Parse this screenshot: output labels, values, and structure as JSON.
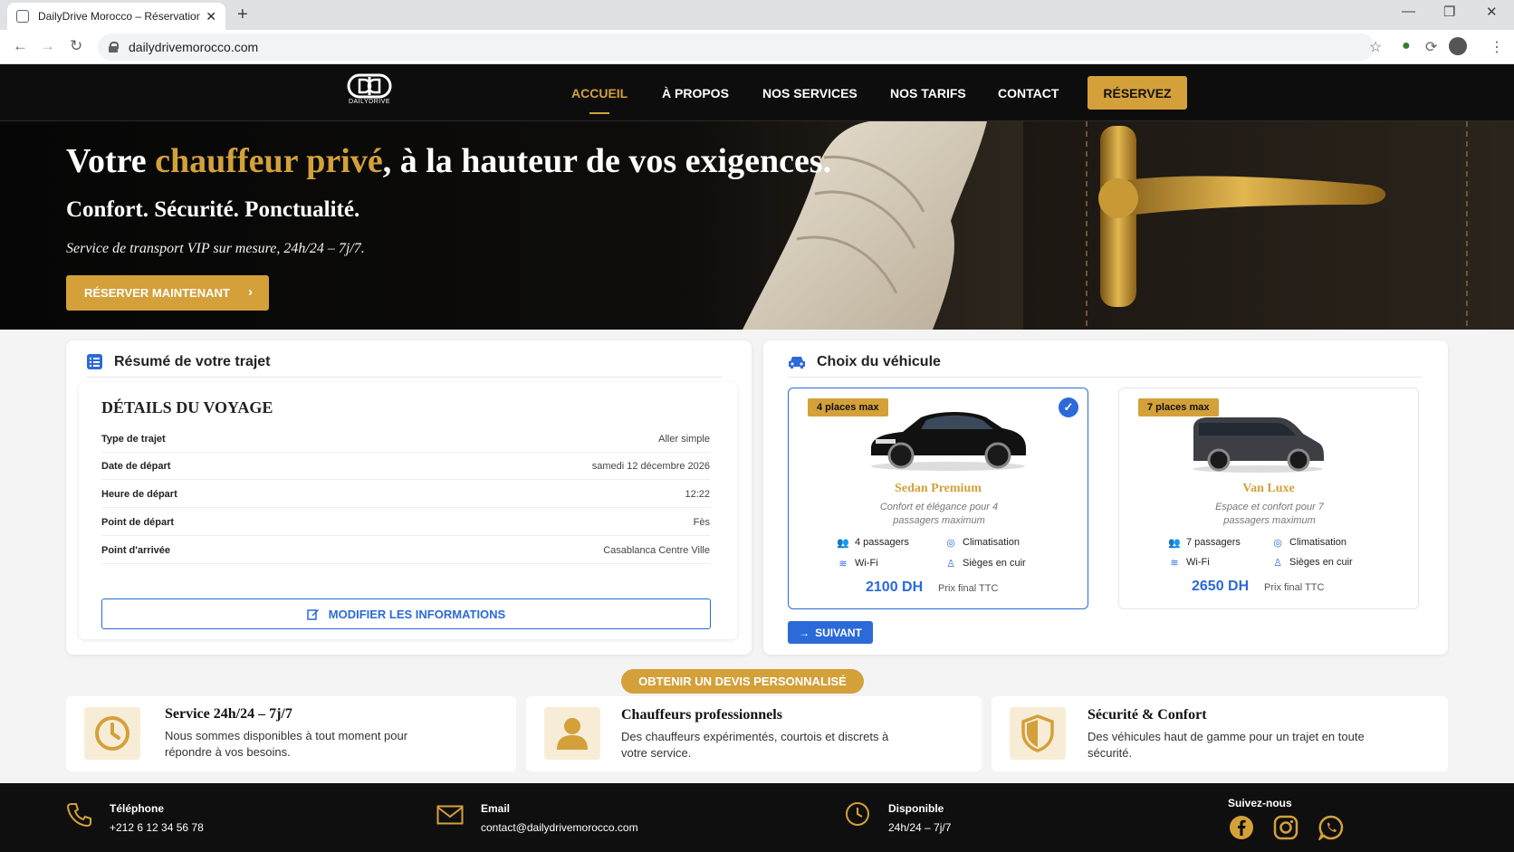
{
  "browser": {
    "tab_title": "DailyDrive Morocco – Réservation",
    "url": "dailydrivemorocco.com"
  },
  "site": {
    "logo_text": "DAILYDRIVE",
    "nav": [
      {
        "label": "ACCUEIL",
        "active": true
      },
      {
        "label": "À PROPOS",
        "active": false
      },
      {
        "label": "NOS SERVICES",
        "active": false
      },
      {
        "label": "NOS TARIFS",
        "active": false
      },
      {
        "label": "CONTACT",
        "active": false
      }
    ],
    "reserve_label": "RÉSERVEZ",
    "accent_color": "#d4a03a",
    "link_color": "#2b6ad8"
  },
  "hero": {
    "title_pre": "Votre ",
    "title_highlight": "chauffeur privé",
    "title_post": ", à la hauteur de vos exigences.",
    "subtitle": "Confort. Sécurité. Ponctualité.",
    "tagline": "Service de transport VIP sur mesure, 24h/24 – 7j/7.",
    "cta_label": "RÉSERVER MAINTENANT"
  },
  "summary": {
    "title": "Résumé de votre trajet",
    "card_title": "DÉTAILS DU VOYAGE",
    "rows": [
      {
        "label": "Type de trajet",
        "value": "Aller simple"
      },
      {
        "label": "Date de départ",
        "value": "samedi 12 décembre 2026"
      },
      {
        "label": "Heure de départ",
        "value": "12:22"
      },
      {
        "label": "Point de départ",
        "value": "Fès"
      },
      {
        "label": "Point d'arrivée",
        "value": "Casablanca Centre Ville"
      }
    ],
    "modify_label": "MODIFIER LES INFORMATIONS"
  },
  "vehicles": {
    "title": "Choix du véhicule",
    "items": [
      {
        "badge": "4 places max",
        "name": "Sedan Premium",
        "desc": "Confort et élégance pour 4 passagers maximum",
        "passengers": "4 passagers",
        "clim": "Climatisation",
        "wifi": "Wi-Fi",
        "seats": "Sièges en cuir",
        "price": "2100 DH",
        "price_note": "Prix final TTC",
        "selected": true
      },
      {
        "badge": "7 places max",
        "name": "Van Luxe",
        "desc": "Espace et confort pour 7 passagers maximum",
        "passengers": "7 passagers",
        "clim": "Climatisation",
        "wifi": "Wi-Fi",
        "seats": "Sièges en cuir",
        "price": "2650 DH",
        "price_note": "Prix final TTC",
        "selected": false
      }
    ],
    "next_label": "SUIVANT"
  },
  "quote_label": "OBTENIR UN DEVIS PERSONNALISÉ",
  "features": [
    {
      "icon": "clock-icon",
      "title": "Service 24h/24 – 7j/7",
      "desc": "Nous sommes disponibles à tout moment pour répondre à vos besoins."
    },
    {
      "icon": "person-icon",
      "title": "Chauffeurs professionnels",
      "desc": "Des chauffeurs expérimentés, courtois et discrets à votre service."
    },
    {
      "icon": "shield-icon",
      "title": "Sécurité & Confort",
      "desc": "Des véhicules haut de gamme pour un trajet en toute sécurité."
    }
  ],
  "footer": {
    "phone_label": "Téléphone",
    "phone_value": "+212 6 12 34 56 78",
    "email_label": "Email",
    "email_value": "contact@dailydrivemorocco.com",
    "avail_label": "Disponible",
    "avail_value": "24h/24 – 7j/7",
    "follow_label": "Suivez-nous",
    "socials": [
      "facebook-icon",
      "instagram-icon",
      "whatsapp-icon"
    ]
  }
}
